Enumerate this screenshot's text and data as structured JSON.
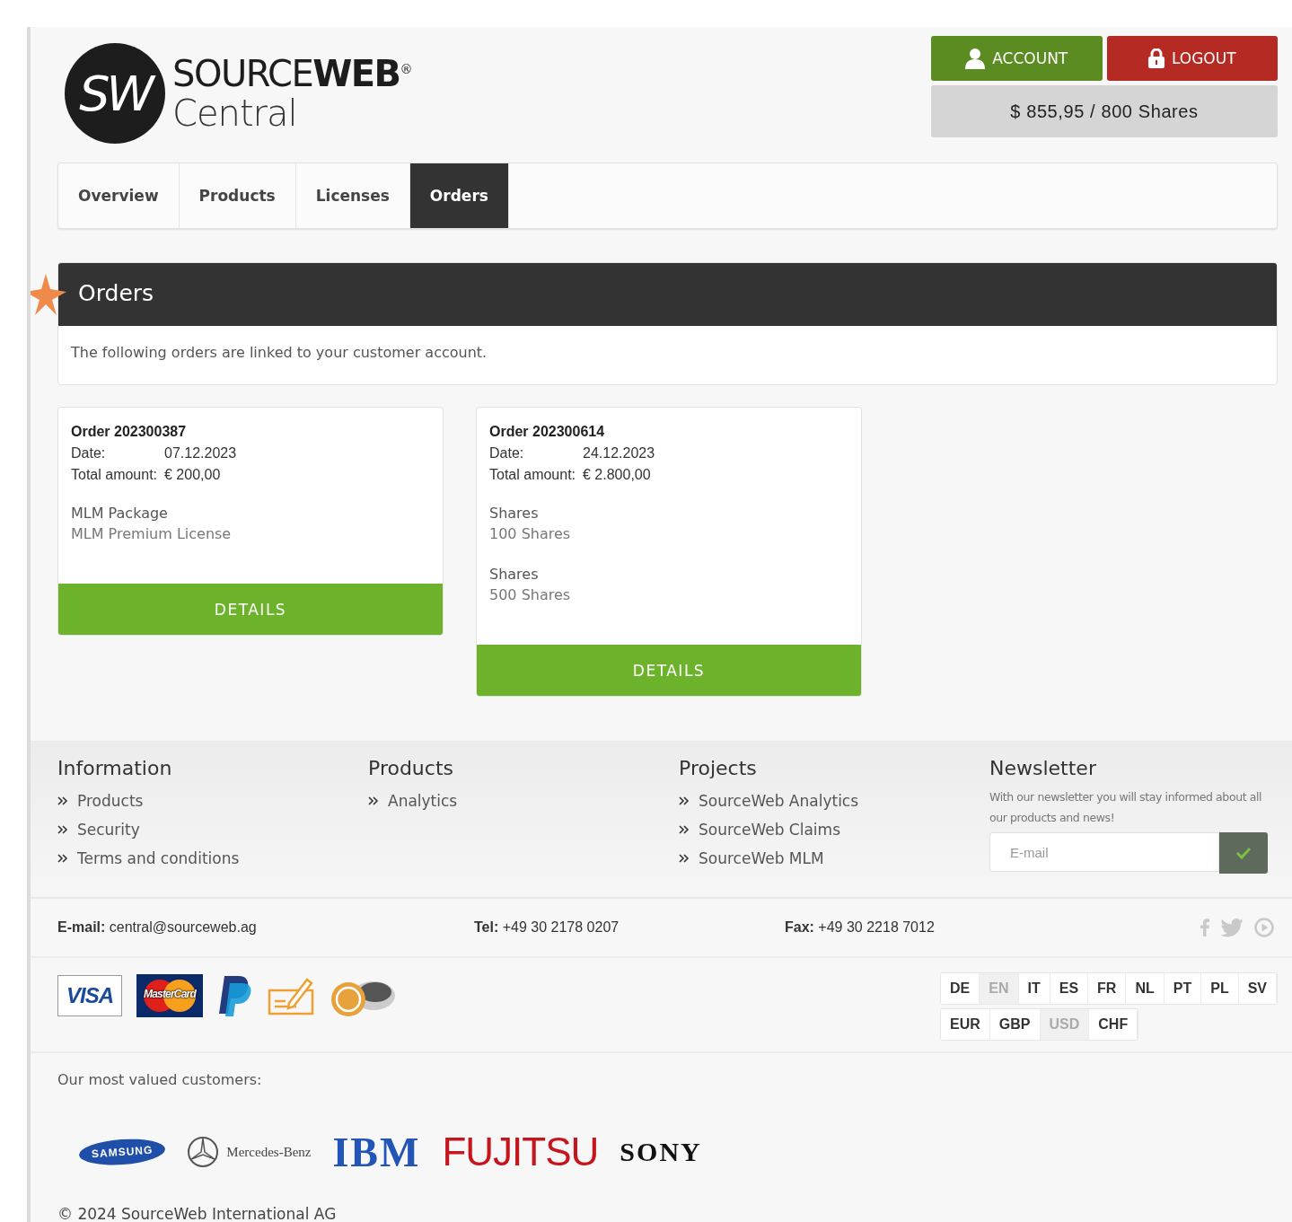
{
  "logo": {
    "mark": "SW",
    "name": "SOURCE**WEB**$^{®}$",
    "subtitle": "Central"
  },
  "account_button": "ACCOUNT",
  "logout_button": "LOGOUT",
  "balance": "$ 855,95 / 800 Shares",
  "tabs": [
    {
      "label": "Overview",
      "selected": false
    },
    {
      "label": "Products",
      "selected": false
    },
    {
      "label": "Licenses",
      "selected": false
    },
    {
      "label": "Orders",
      "selected": true
    }
  ],
  "orders_panel": {
    "title": "Orders",
    "description": "The following orders are linked to your customer account."
  },
  "orders": [
    {
      "title": "Order 202300387",
      "fields": [
        {
          "label": "Date:",
          "value": "07.12.2023"
        },
        {
          "label": "Total amount:",
          "value": "€ 200,00"
        }
      ],
      "items": [
        {
          "name": "MLM Package",
          "detail": "MLM Premium License"
        }
      ],
      "button": "DETAILS"
    },
    {
      "title": "Order 202300614",
      "fields": [
        {
          "label": "Date:",
          "value": "24.12.2023"
        },
        {
          "label": "Total amount:",
          "value": "€ 2.800,00"
        }
      ],
      "items": [
        {
          "name": "Shares",
          "detail": "100 Shares"
        },
        {
          "name": "Shares",
          "detail": "500 Shares"
        }
      ],
      "button": "DETAILS"
    }
  ],
  "footer_columns": [
    {
      "heading": "Information",
      "links": [
        "Products",
        "Security",
        "Terms and conditions"
      ]
    },
    {
      "heading": "Products",
      "links": [
        "Analytics"
      ]
    },
    {
      "heading": "Projects",
      "links": [
        "SourceWeb Analytics",
        "SourceWeb Claims",
        "SourceWeb MLM"
      ]
    }
  ],
  "newsletter": {
    "heading": "Newsletter",
    "text": "With our newsletter you will stay informed about all our products and news!",
    "placeholder": "E-mail"
  },
  "contacts": [
    {
      "label": "E-mail:",
      "value": "central@sourceweb.ag"
    },
    {
      "label": "Tel:",
      "value": "+49 30 2178 0207"
    },
    {
      "label": "Fax:",
      "value": "+49 30 2218 7012"
    }
  ],
  "payment_methods": [
    {
      "kind": "visa",
      "label": "VISA"
    },
    {
      "kind": "mastercard",
      "label": "MasterCard"
    },
    {
      "kind": "paypal"
    },
    {
      "kind": "cheque"
    },
    {
      "kind": "bitcoin"
    }
  ],
  "languages": [
    {
      "label": "DE",
      "selected": false
    },
    {
      "label": "EN",
      "selected": true
    },
    {
      "label": "IT",
      "selected": false
    },
    {
      "label": "ES",
      "selected": false
    },
    {
      "label": "FR",
      "selected": false
    },
    {
      "label": "NL",
      "selected": false
    },
    {
      "label": "PT",
      "selected": false
    },
    {
      "label": "PL",
      "selected": false
    },
    {
      "label": "SV",
      "selected": false
    }
  ],
  "currencies": [
    {
      "label": "EUR",
      "selected": false
    },
    {
      "label": "GBP",
      "selected": false
    },
    {
      "label": "USD",
      "selected": true
    },
    {
      "label": "CHF",
      "selected": false
    }
  ],
  "customers_heading": "Our most valued customers:",
  "customers": [
    {
      "kind": "samsung",
      "label": "SAMSUNG"
    },
    {
      "kind": "mercedes",
      "label": "Mercedes-Benz"
    },
    {
      "kind": "ibm",
      "label": "IBM"
    },
    {
      "kind": "fujitsu",
      "label": "FUJITSU"
    },
    {
      "kind": "sony",
      "label": "SONY"
    }
  ],
  "copyright": "© 2024 SourceWeb International AG"
}
